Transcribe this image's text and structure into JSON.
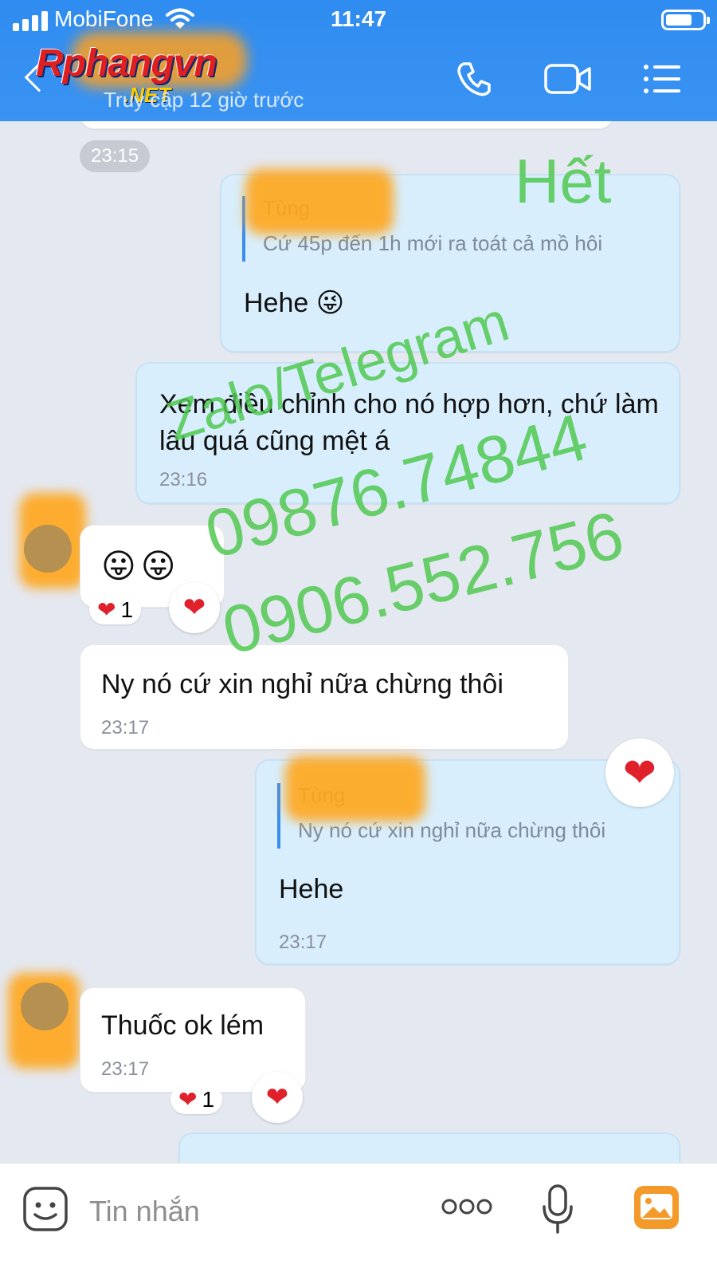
{
  "status_bar": {
    "carrier": "MobiFone",
    "time": "11:47",
    "signal_bars": 4,
    "wifi_icon": "wifi-icon",
    "battery_icon": "battery-icon"
  },
  "header": {
    "logo_main": "Rphangvn",
    "logo_suffix": ".NET",
    "last_seen": "Truy cập 12 giờ trước",
    "icons": [
      "phone-icon",
      "video-call-icon",
      "menu-list-icon"
    ],
    "accent": "#3a93f2"
  },
  "chat": {
    "top_time": "23:15",
    "messages": [
      {
        "direction": "out",
        "quote_name": "Tùng",
        "quote_text": "Cứ 45p đến 1h mới ra toát cả mồ hôi",
        "text": "Hehe 😜"
      },
      {
        "direction": "out",
        "text": "Xem điều chỉnh cho nó hợp hơn, chứ làm lâu quá cũng mệt á",
        "time": "23:16"
      },
      {
        "direction": "in",
        "text": "😛😛",
        "reaction_count": "1"
      },
      {
        "direction": "in",
        "text": "Ny nó cứ xin nghỉ nữa chừng thôi",
        "time": "23:17"
      },
      {
        "direction": "out",
        "quote_name": "Tùng",
        "quote_text": "Ny nó cứ xin nghỉ nữa chừng thôi",
        "text": "Hehe",
        "time": "23:17"
      },
      {
        "direction": "in",
        "text": "Thuốc ok lém",
        "time": "23:17",
        "reaction_count": "1"
      }
    ],
    "heart_color": "#e0202a"
  },
  "watermark": {
    "end": "Hết",
    "contact": "Zalo/Telegram",
    "phone1": "09876.74844",
    "phone2": "0906.552.756",
    "color": "#50c850"
  },
  "input_bar": {
    "placeholder": "Tin nhắn",
    "icons": [
      "sticker-icon",
      "more-dots-icon",
      "microphone-icon",
      "image-icon"
    ]
  }
}
